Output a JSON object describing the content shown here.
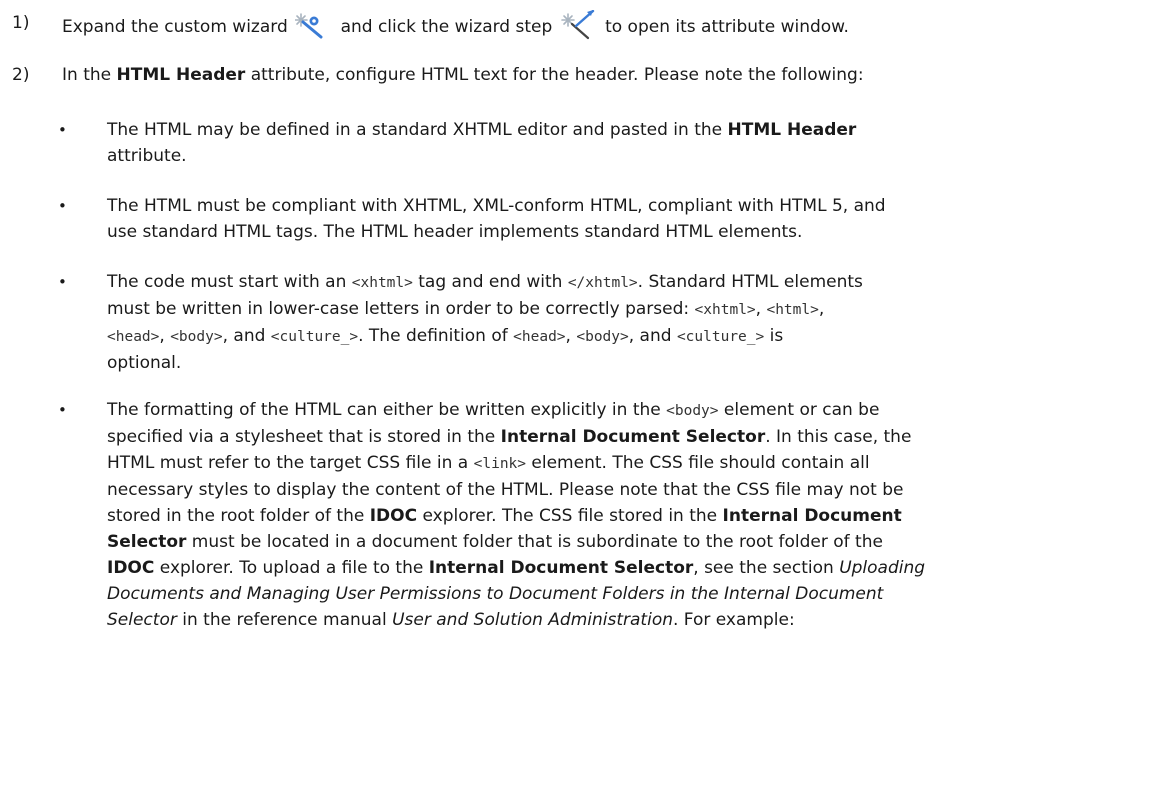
{
  "steps": [
    {
      "num": "1)",
      "parts": {
        "a": "Expand the custom wizard",
        "b": "and click the wizard step",
        "c": "to open its attribute window."
      }
    },
    {
      "num": "2)",
      "parts": {
        "a": "In the ",
        "b": "HTML Header",
        "c": " attribute, configure HTML text for the header. Please note the following:"
      }
    }
  ],
  "icons": {
    "wizard": "custom-wizard-icon",
    "wizard_step": "wizard-step-icon"
  },
  "bullets": [
    {
      "t1": "The HTML may be defined in a standard XHTML editor and pasted in the ",
      "t2": "HTML Header",
      "t3": "attribute."
    },
    {
      "t1": "The HTML must be compliant with XHTML, XML-conform HTML, compliant with HTML 5, and",
      "t2": "use standard HTML tags. The HTML header implements standard HTML elements."
    },
    {
      "t1": "The code must start with an ",
      "c1": "<xhtml>",
      "t2": " tag and end with ",
      "c2": "</xhtml>",
      "t3": ". Standard HTML elements",
      "t4": "must be written in lower-case letters in order to be correctly parsed: ",
      "c3": "<xhtml>",
      "t5": ", ",
      "c4": "<html>",
      "t6": ",",
      "c5": "<head>",
      "t7": ", ",
      "c6": "<body>",
      "t8": ", and ",
      "c7": "<culture_>",
      "t9": ". The definition of ",
      "c8": "<head>",
      "t10": ", ",
      "c9": "<body>",
      "t11": ", and ",
      "c10": "<culture_>",
      "t12": " is",
      "t13": "optional."
    },
    {
      "l1a": "The formatting of the HTML can either be written explicitly in the ",
      "l1c": "<body>",
      "l1b": " element or can be",
      "l2a": "specified via a stylesheet that is stored in the ",
      "l2b": "Internal Document Selector",
      "l2c": ". In this case, the",
      "l3a": "HTML must refer to the target CSS file in a ",
      "l3c": "<link>",
      "l3b": " element. The CSS file should contain all",
      "l4": "necessary styles to display the content of the HTML. Please note that the CSS file may not be",
      "l5a": "stored in the root folder of the ",
      "l5b": "IDOC",
      "l5c": " explorer. The CSS file stored in the ",
      "l5d": "Internal Document",
      "l6a": "Selector",
      "l6b": " must be located in a document folder that is subordinate to the root folder of the",
      "l7a": "IDOC",
      "l7b": " explorer. To upload a file to the ",
      "l7c": "Internal Document Selector",
      "l7d": ", see the section ",
      "l7e": "Uploading",
      "l8": "Documents and Managing User Permissions to Document Folders in the Internal Document",
      "l9a": "Selector",
      "l9b": " in the reference manual ",
      "l9c": "User and Solution Administration",
      "l9d": ". For example:"
    }
  ],
  "colors": {
    "text": "#1a1a1a",
    "icon_blue": "#3a7bd5",
    "icon_sparkle": "#a9b4bf"
  }
}
